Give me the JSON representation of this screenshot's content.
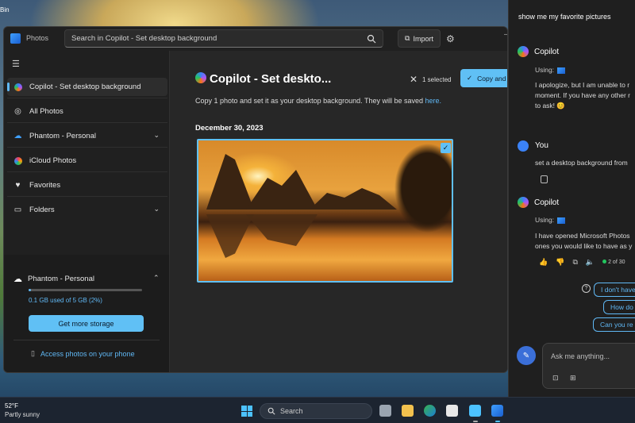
{
  "desktop": {
    "recycle_label": "Bin"
  },
  "photos_window": {
    "app_name": "Photos",
    "search_text": "Search in Copilot - Set desktop background",
    "import_label": "Import",
    "sidebar": {
      "items": [
        {
          "label": "Copilot - Set desktop background",
          "icon": "copilot-icon"
        },
        {
          "label": "All Photos",
          "icon": "photos-icon"
        },
        {
          "label": "Phantom - Personal",
          "icon": "onedrive-icon"
        },
        {
          "label": "iCloud Photos",
          "icon": "icloud-icon"
        },
        {
          "label": "Favorites",
          "icon": "heart-icon"
        },
        {
          "label": "Folders",
          "icon": "folder-icon"
        }
      ]
    },
    "storage": {
      "title": "Phantom - Personal",
      "usage_text": "0.1 GB used of 5 GB (2%)",
      "usage_fraction": 0.02,
      "button_label": "Get more storage",
      "phone_link": "Access photos on your phone"
    },
    "main": {
      "title": "Copilot - Set deskto...",
      "selected_text": "1 selected",
      "copy_button": "Copy and se",
      "description": "Copy 1 photo and set it as your desktop background. They will be saved ",
      "description_link": "here.",
      "date_header": "December 30, 2023"
    }
  },
  "copilot_panel": {
    "user_prompt_1": "show me my favorite pictures",
    "reply_1": {
      "sender": "Copilot",
      "using": "Using:",
      "lines": [
        "I apologize, but I am unable to r",
        "moment. If you have any other r",
        "to ask! 😊"
      ]
    },
    "user_2": {
      "sender": "You",
      "text": "set a desktop background from"
    },
    "reply_2": {
      "sender": "Copilot",
      "using": "Using:",
      "lines": [
        "I have opened Microsoft Photos",
        "ones you would like to have as y"
      ],
      "page_count": "2 of 30"
    },
    "suggestions": [
      "I don't have",
      "How do",
      "Can you re"
    ],
    "input_placeholder": "Ask me anything..."
  },
  "taskbar": {
    "temperature": "52°F",
    "weather": "Partly sunny",
    "search_label": "Search"
  }
}
